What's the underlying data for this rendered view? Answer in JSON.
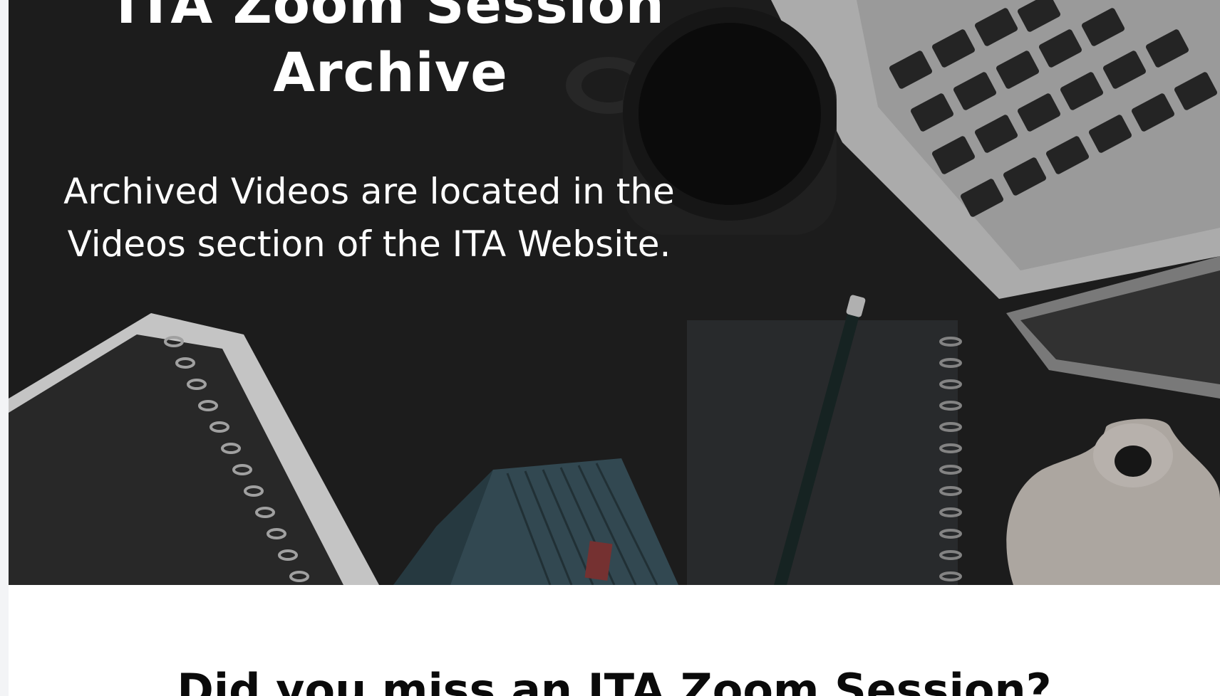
{
  "hero": {
    "title": "ITA Zoom Session Archive",
    "subtitle": "Archived Videos are located in the Videos section of the ITA Website.",
    "background_color": "#1f1f1f"
  },
  "section": {
    "heading": "Did you miss an ITA Zoom Session?"
  },
  "colors": {
    "hero_text": "#ffffff",
    "page_background": "#ffffff",
    "heading_text": "#0a0a0a"
  }
}
